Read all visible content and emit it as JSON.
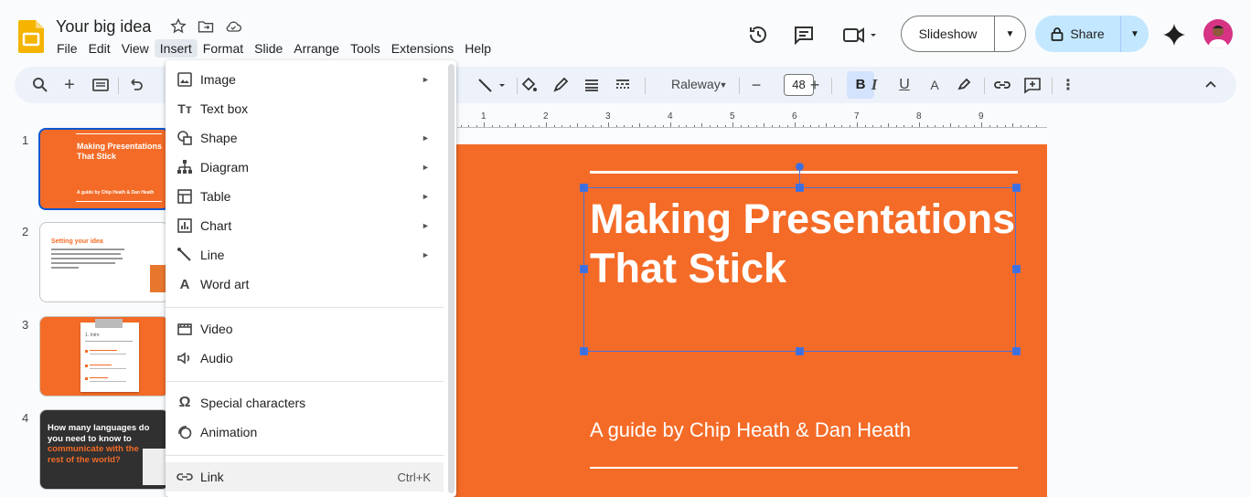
{
  "doc": {
    "title": "Your big idea"
  },
  "menubar": [
    "File",
    "Edit",
    "View",
    "Insert",
    "Format",
    "Slide",
    "Arrange",
    "Tools",
    "Extensions",
    "Help"
  ],
  "header": {
    "slideshow_label": "Slideshow",
    "share_label": "Share"
  },
  "toolbar": {
    "font": "Raleway",
    "font_size": "48"
  },
  "ruler": [
    "1",
    "2",
    "3",
    "4",
    "5",
    "6",
    "7",
    "8",
    "9"
  ],
  "thumbnails": [
    {
      "num": "1",
      "title": "Making Presentations That Stick",
      "sub": "A guide by Chip Heath & Dan Heath"
    },
    {
      "num": "2",
      "title": "Setting your idea"
    },
    {
      "num": "3",
      "title": "1. Intro"
    },
    {
      "num": "4",
      "title_a": "How many languages do you need to know to",
      "title_b": "communicate with the rest of the world?"
    }
  ],
  "slide": {
    "title": "Making Presentations That Stick",
    "subtitle": "A guide by Chip Heath & Dan Heath"
  },
  "insert_menu": {
    "items": [
      {
        "label": "Image",
        "icon": "image-icon",
        "submenu": true
      },
      {
        "label": "Text box",
        "icon": "textbox-icon",
        "submenu": false
      },
      {
        "label": "Shape",
        "icon": "shape-icon",
        "submenu": true
      },
      {
        "label": "Diagram",
        "icon": "diagram-icon",
        "submenu": true
      },
      {
        "label": "Table",
        "icon": "table-icon",
        "submenu": true
      },
      {
        "label": "Chart",
        "icon": "chart-icon",
        "submenu": true
      },
      {
        "label": "Line",
        "icon": "line-icon",
        "submenu": true
      },
      {
        "label": "Word art",
        "icon": "wordart-icon",
        "submenu": false
      },
      {
        "label": "Video",
        "icon": "video-icon",
        "submenu": false
      },
      {
        "label": "Audio",
        "icon": "audio-icon",
        "submenu": false
      },
      {
        "label": "Special characters",
        "icon": "omega-icon",
        "submenu": false
      },
      {
        "label": "Animation",
        "icon": "animation-icon",
        "submenu": false
      },
      {
        "label": "Link",
        "icon": "link-icon",
        "submenu": false,
        "shortcut": "Ctrl+K"
      }
    ]
  },
  "colors": {
    "accent": "#0b57d0",
    "slide_bg": "#f46b27",
    "share_bg": "#c2e7ff"
  }
}
